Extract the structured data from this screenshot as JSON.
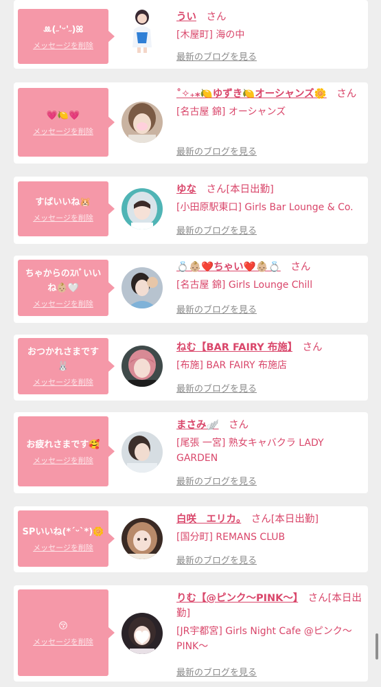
{
  "delete_label": "メッセージを削除",
  "blog_label": "最新のブログを見る",
  "honorific": "さん",
  "colors": {
    "accent": "#d9466a",
    "bubble": "#f598a8",
    "background": "#eeeeee"
  },
  "messages": [
    {
      "message": "ꔛ(˶'ᵕ'˶)ꕤ",
      "name": "うい",
      "status": "",
      "shop": "[木屋町] 海の中"
    },
    {
      "message": "💗🍋💗",
      "name": "˚✧₊⁎🍋ゆずき🍋オーシャンズ🌼",
      "status": "",
      "shop": "[名古屋 錦] オーシャンズ"
    },
    {
      "message": "すばいいね🐹",
      "name": "ゆな",
      "status": "[本日出勤]",
      "shop": "[小田原駅東口] Girls Bar Lounge & Co."
    },
    {
      "message": "ちゃからのｽﾊﾞいいね👶🏼🤍",
      "name": "💍👶🏼❤️ちゃい❤️👶🏼💍",
      "status": "",
      "shop": "[名古屋 錦] Girls Lounge Chill"
    },
    {
      "message": "おつかれさまです🐰",
      "name": "ねむ【BAR FAIRY 布施】",
      "status": "",
      "shop": "[布施] BAR FAIRY 布施店"
    },
    {
      "message": "お疲れさまです🥰",
      "name": "まさみ🪽",
      "status": "",
      "shop": "[尾張 一宮] 熟女キャバクラ LADY GARDEN"
    },
    {
      "message": "SPいいね(*´ᵕ`*)🌼",
      "name": "白咲　エリカ。",
      "status": "[本日出勤]",
      "shop": "[国分町] REMANS CLUB"
    },
    {
      "message": "😚",
      "name": "りむ【@ピンク〜PINK〜】",
      "status": "[本日出勤]",
      "shop": "[JR宇都宮] Girls Night Cafe @ピンク〜PINK〜"
    }
  ]
}
